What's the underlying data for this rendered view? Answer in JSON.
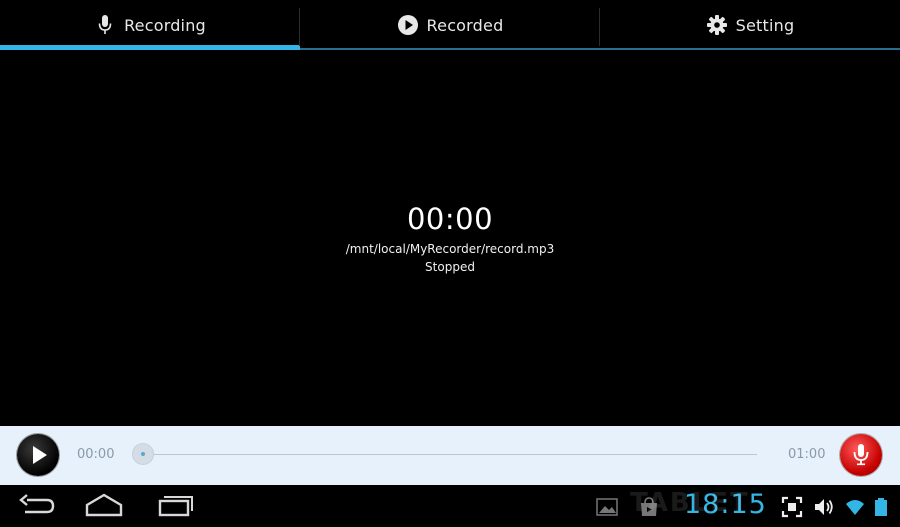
{
  "tabs": [
    {
      "label": "Recording",
      "icon": "microphone-icon",
      "active": true
    },
    {
      "label": "Recorded",
      "icon": "play-circle-icon",
      "active": false
    },
    {
      "label": "Setting",
      "icon": "gear-icon",
      "active": false
    }
  ],
  "main": {
    "timer": "00:00",
    "file_path": "/mnt/local/MyRecorder/record.mp3",
    "status": "Stopped"
  },
  "player": {
    "time_start": "00:00",
    "time_end": "01:00",
    "progress": 0
  },
  "system_bar": {
    "clock": "18:15",
    "watermark": "TABLET"
  },
  "colors": {
    "accent": "#33b5e5",
    "player_bg": "#e7f1fb",
    "record_red": "#d40000"
  }
}
